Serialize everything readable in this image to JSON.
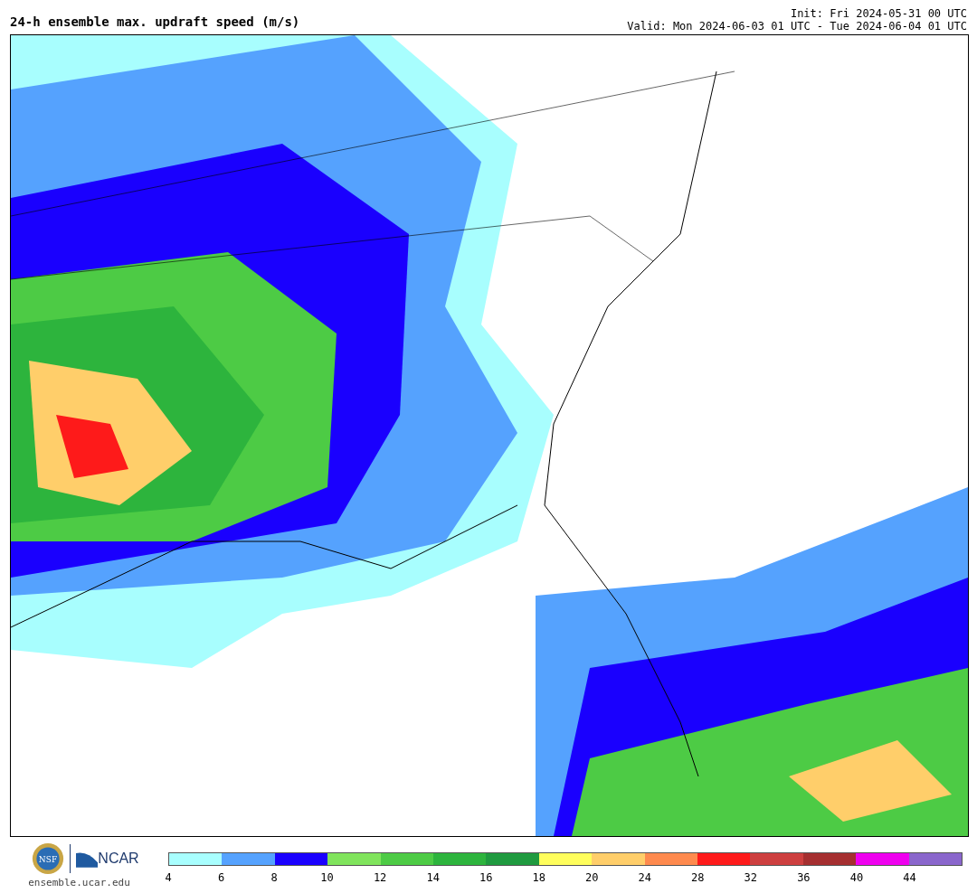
{
  "header": {
    "title": "24-h ensemble max. updraft speed (m/s)",
    "init": "Init: Fri 2024-05-31 00 UTC",
    "valid": "Valid: Mon 2024-06-03 01 UTC - Tue 2024-06-04 01 UTC"
  },
  "footer": {
    "logos": {
      "nsf": "NSF",
      "ncar": "NCAR"
    },
    "site": "ensemble.ucar.edu"
  },
  "legend": {
    "bins": [
      {
        "color": "#a8fefe",
        "tick": "4"
      },
      {
        "color": "#55a2fe",
        "tick": "6"
      },
      {
        "color": "#1a00fe",
        "tick": "8"
      },
      {
        "color": "#80e45c",
        "tick": "10"
      },
      {
        "color": "#4dcb45",
        "tick": "12"
      },
      {
        "color": "#2db43d",
        "tick": "14"
      },
      {
        "color": "#1f9a3f",
        "tick": "16"
      },
      {
        "color": "#fffe5c",
        "tick": "18"
      },
      {
        "color": "#ffce6a",
        "tick": "20"
      },
      {
        "color": "#fe8a4e",
        "tick": "24"
      },
      {
        "color": "#fe1a1a",
        "tick": "28"
      },
      {
        "color": "#cd3f3f",
        "tick": "32"
      },
      {
        "color": "#a52f30",
        "tick": "36"
      },
      {
        "color": "#ef00ef",
        "tick": "40"
      },
      {
        "color": "#8a66cc",
        "tick": "44"
      }
    ]
  }
}
